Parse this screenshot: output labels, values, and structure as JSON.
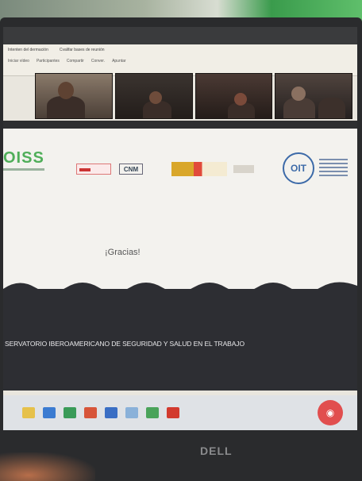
{
  "window": {
    "menu_row1": [
      "Intenten del dermación",
      "Cvalifar bases de reunión"
    ],
    "menu_row2": [
      "Iniciar vídeo",
      "Participantes",
      "Compartir",
      "Conver.",
      "Apuntar"
    ]
  },
  "video_tiles": [
    {
      "name": "participant-1"
    },
    {
      "name": "participant-2"
    },
    {
      "name": "participant-3"
    },
    {
      "name": "participant-4"
    }
  ],
  "slide": {
    "logos": {
      "oiss": "OISS",
      "cnm": "CNM",
      "oit": "OIT"
    },
    "thanks_text": "¡Gracias!",
    "band_title": "SERVATORIO IBEROAMERICANO DE SEGURIDAD Y SALUD EN EL TRABAJO"
  },
  "taskbar": {
    "icons": [
      {
        "name": "file-icon",
        "color": "#e6c14b"
      },
      {
        "name": "mail-icon",
        "color": "#3b7bd1"
      },
      {
        "name": "excel-icon",
        "color": "#3a9b58"
      },
      {
        "name": "powerpoint-icon",
        "color": "#d7553a"
      },
      {
        "name": "word-icon",
        "color": "#3a6ec4"
      },
      {
        "name": "zoom-icon",
        "color": "#8ab1d9"
      },
      {
        "name": "chrome-icon",
        "color": "#4aa35a"
      },
      {
        "name": "acrobat-icon",
        "color": "#d23a2e"
      }
    ],
    "record_label": "◉"
  },
  "monitor": {
    "brand": "DELL"
  },
  "colors": {
    "oiss_green": "#4fae59",
    "oit_blue": "#3c6aa8",
    "band_dark": "#2d2e33"
  }
}
